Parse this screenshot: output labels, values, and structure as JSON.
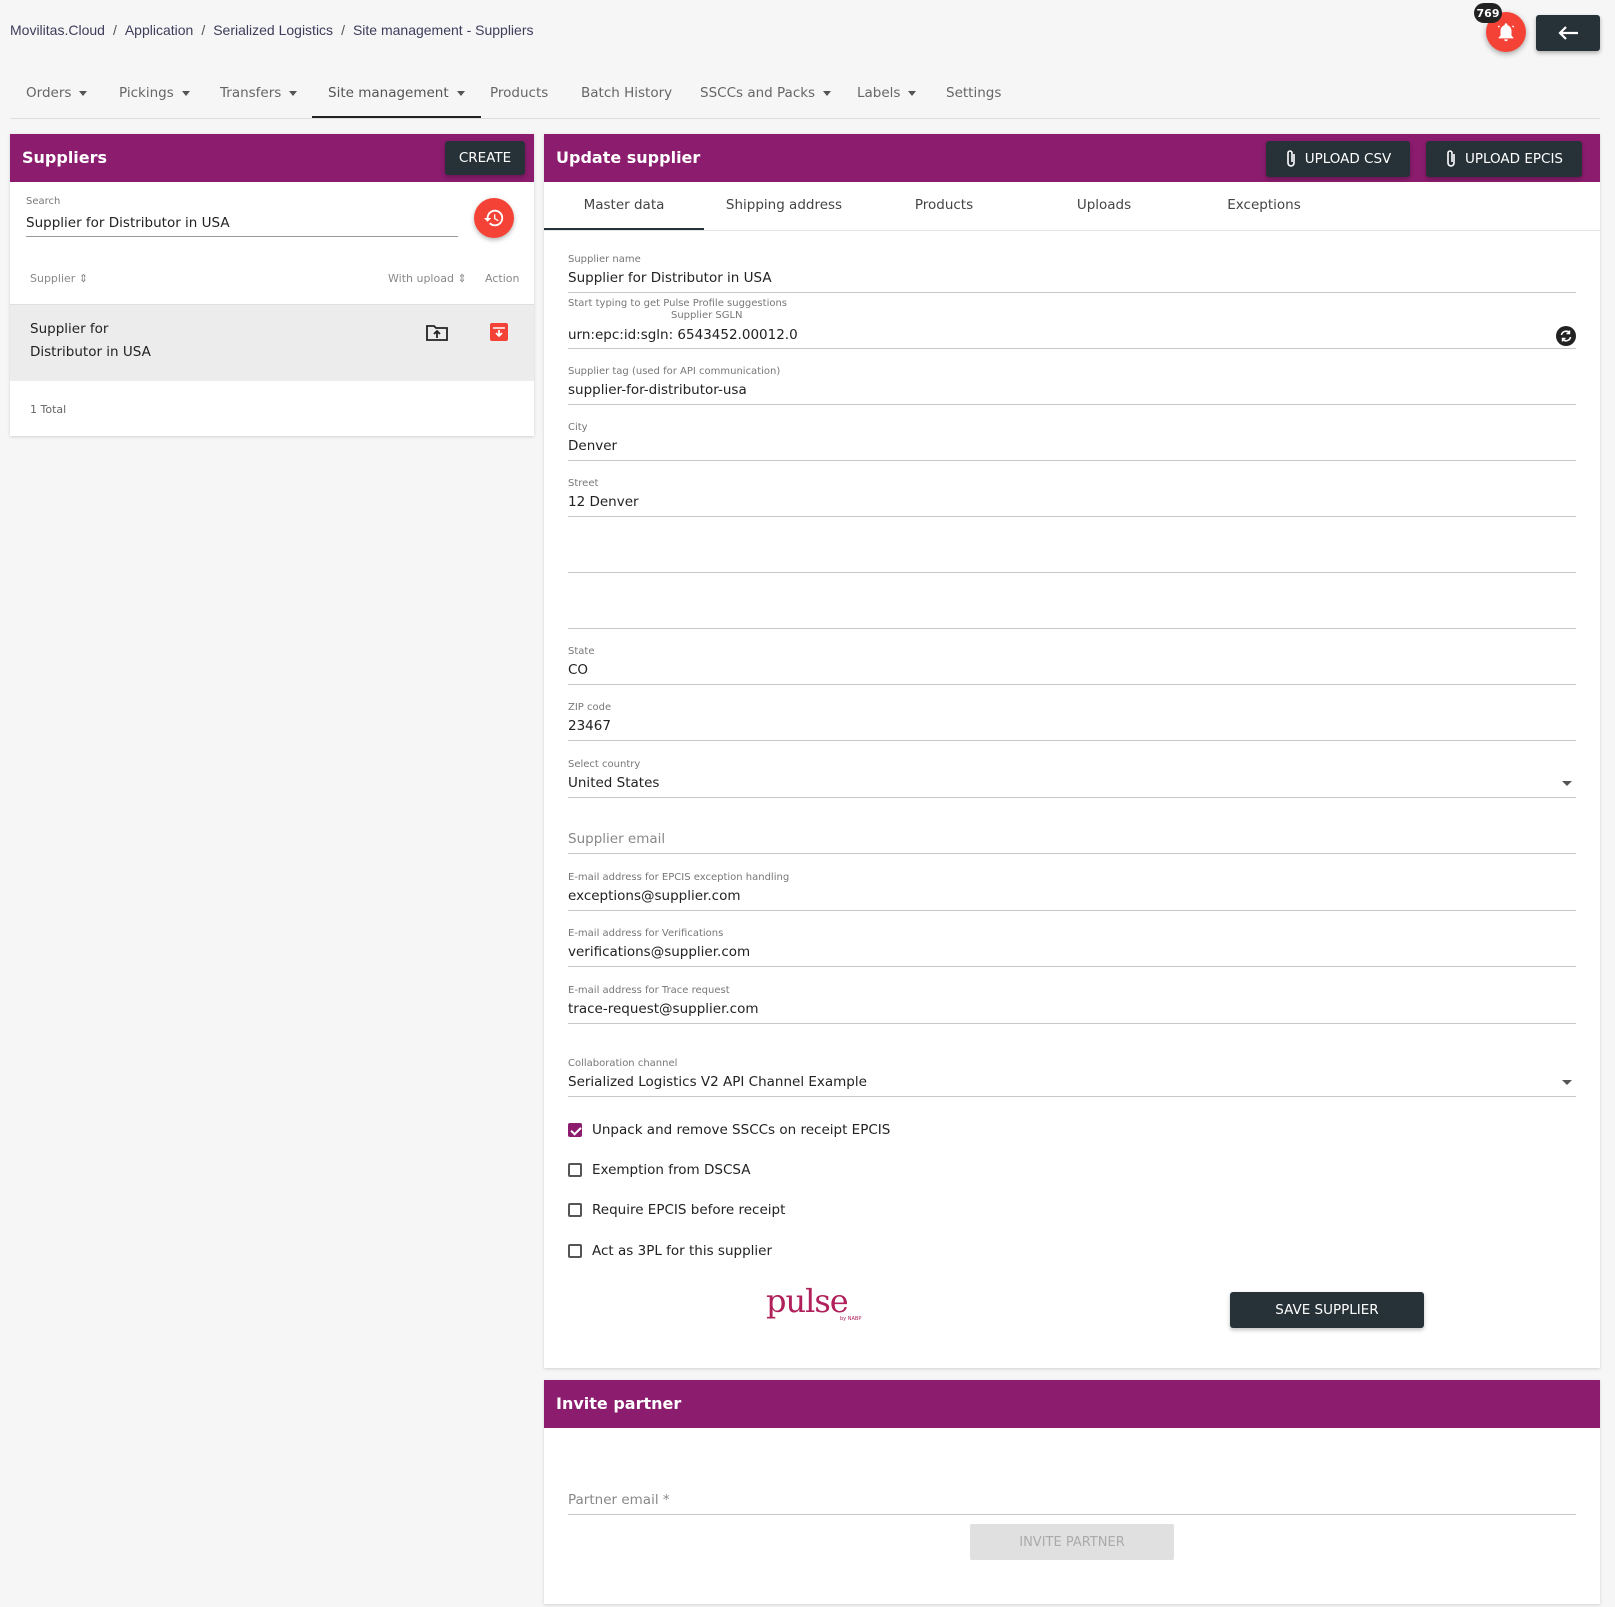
{
  "breadcrumb": [
    "Movilitas.Cloud",
    "Application",
    "Serialized Logistics",
    "Site management - Suppliers"
  ],
  "notifications": {
    "count": "769",
    "icon": "bell-icon"
  },
  "back_icon": "arrow-left-icon",
  "nav": {
    "orders": "Orders",
    "pickings": "Pickings",
    "transfers": "Transfers",
    "site_management": "Site management",
    "products": "Products",
    "batch_history": "Batch History",
    "ssccs": "SSCCs and Packs",
    "labels": "Labels",
    "settings": "Settings"
  },
  "suppliers_panel": {
    "title": "Suppliers",
    "create_label": "CREATE",
    "search_label": "Search",
    "search_value": "Supplier for Distributor in USA",
    "columns": {
      "supplier": "Supplier",
      "with_upload": "With upload",
      "action": "Action"
    },
    "rows": [
      {
        "line1": "Supplier for",
        "line2": "Distributor in USA"
      }
    ],
    "total": "1 Total"
  },
  "update_panel": {
    "title": "Update supplier",
    "upload_csv": "UPLOAD CSV",
    "upload_epcis": "UPLOAD EPCIS",
    "tabs": [
      "Master data",
      "Shipping address",
      "Products",
      "Uploads",
      "Exceptions"
    ],
    "fields": {
      "supplier_name_label": "Supplier name",
      "supplier_name": "Supplier for Distributor in USA",
      "pulse_hint": "Start typing to get Pulse Profile suggestions",
      "sgln_label": "Supplier SGLN",
      "sgln": "urn:epc:id:sgln: 6543452.00012.0",
      "tag_label": "Supplier tag (used for API communication)",
      "tag": "supplier-for-distributor-usa",
      "city_label": "City",
      "city": "Denver",
      "street_label": "Street",
      "street": "12 Denver",
      "state_label": "State",
      "state": "CO",
      "zip_label": "ZIP code",
      "zip": "23467",
      "country_label": "Select country",
      "country": "United States",
      "email_placeholder": "Supplier email",
      "epcis_email_label": "E-mail address for EPCIS exception handling",
      "epcis_email": "exceptions@supplier.com",
      "verif_email_label": "E-mail address for Verifications",
      "verif_email": "verifications@supplier.com",
      "trace_email_label": "E-mail address for Trace request",
      "trace_email": "trace-request@supplier.com",
      "channel_label": "Collaboration channel",
      "channel": "Serialized Logistics V2 API Channel Example"
    },
    "checkboxes": {
      "unpack": "Unpack and remove SSCCs on receipt EPCIS",
      "exemption": "Exemption from DSCSA",
      "require_epcis": "Require EPCIS before receipt",
      "act_3pl": "Act as 3PL for this supplier"
    },
    "logo": {
      "word": "pulse",
      "sub": "by NABP"
    },
    "save_label": "SAVE SUPPLIER"
  },
  "invite_panel": {
    "title": "Invite partner",
    "email_placeholder": "Partner email *",
    "invite_label": "INVITE PARTNER"
  },
  "colors": {
    "header": "#8b1c6e",
    "dark": "#263238",
    "accent_red": "#f44336"
  }
}
